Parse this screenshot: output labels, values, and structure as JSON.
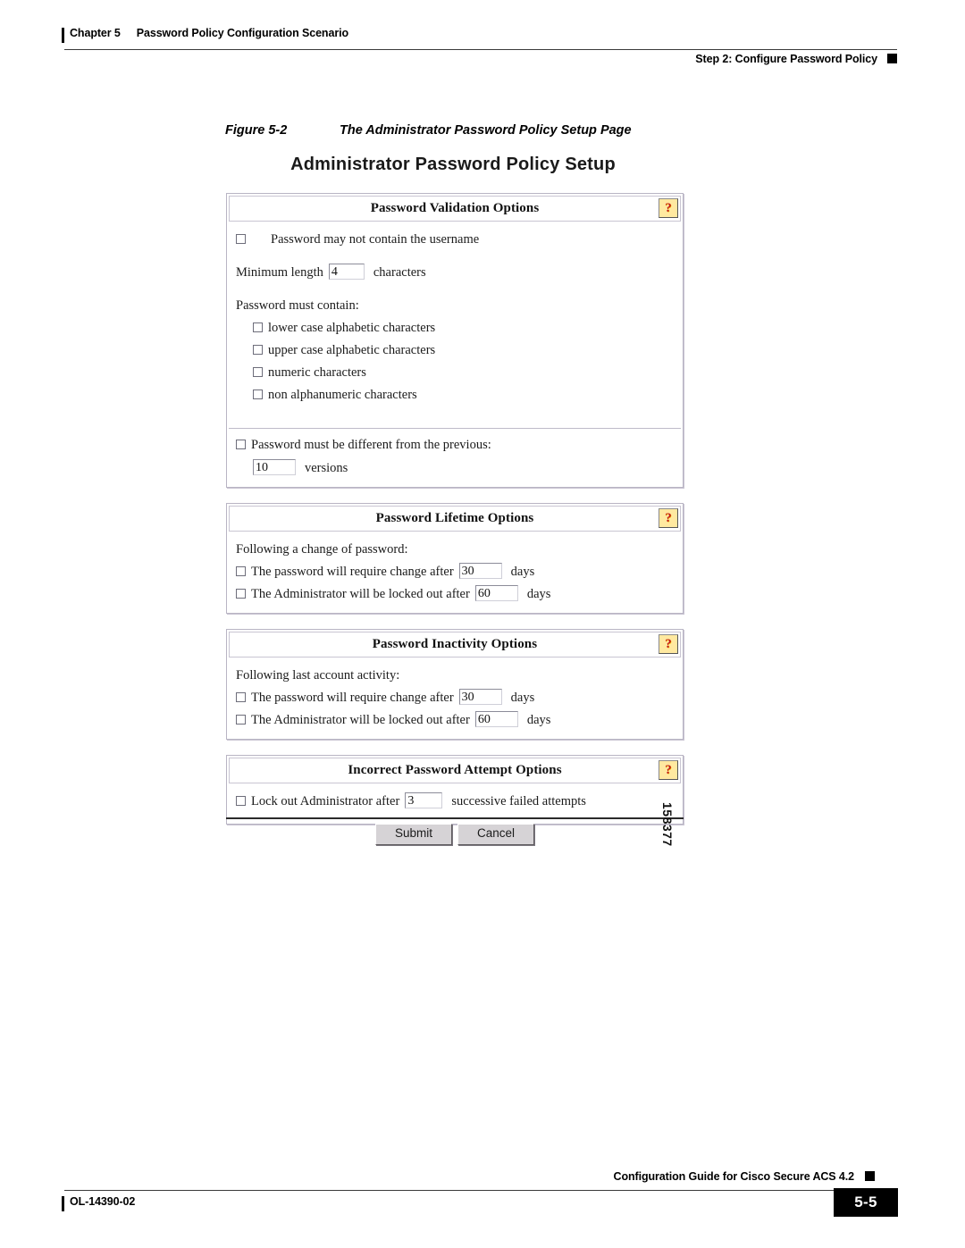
{
  "header": {
    "chapter_label": "Chapter 5",
    "chapter_title": "Password Policy Configuration Scenario",
    "section_title": "Step 2: Configure Password Policy"
  },
  "figure": {
    "number": "Figure 5-2",
    "caption": "The Administrator Password Policy Setup Page",
    "figure_id": "158377"
  },
  "app": {
    "title": "Administrator Password Policy Setup",
    "help_icon_glyph": "?",
    "help_icon_color": "#c21a1a",
    "help_icon_bg": "#ffe9a0"
  },
  "validation": {
    "panel_title": "Password Validation Options",
    "username_rule_label": "Password may not contain the username",
    "min_length_prefix": "Minimum length",
    "min_length_value": "4",
    "min_length_suffix": "characters",
    "must_contain_label": "Password must contain:",
    "must_contain_items": [
      "lower case alphabetic characters",
      "upper case alphabetic characters",
      "numeric characters",
      "non alphanumeric characters"
    ],
    "different_label": "Password must be different from the previous:",
    "versions_value": "10",
    "versions_suffix": "versions"
  },
  "lifetime": {
    "panel_title": "Password Lifetime Options",
    "intro": "Following a change of password:",
    "require_change_prefix": "The password will require change after",
    "require_change_value": "30",
    "require_change_suffix": "days",
    "lockout_prefix": "The Administrator will be locked out after",
    "lockout_value": "60",
    "lockout_suffix": "days"
  },
  "inactivity": {
    "panel_title": "Password Inactivity Options",
    "intro": "Following last account activity:",
    "require_change_prefix": "The password will require change after",
    "require_change_value": "30",
    "require_change_suffix": "days",
    "lockout_prefix": "The Administrator will be locked out after",
    "lockout_value": "60",
    "lockout_suffix": "days"
  },
  "attempts": {
    "panel_title": "Incorrect Password Attempt Options",
    "lock_prefix": "Lock out Administrator after",
    "lock_value": "3",
    "lock_suffix": "successive failed attempts"
  },
  "actions": {
    "submit_label": "Submit",
    "cancel_label": "Cancel"
  },
  "footer": {
    "guide_title": "Configuration Guide for Cisco Secure ACS 4.2",
    "doc_number": "OL-14390-02",
    "page_number": "5-5"
  }
}
